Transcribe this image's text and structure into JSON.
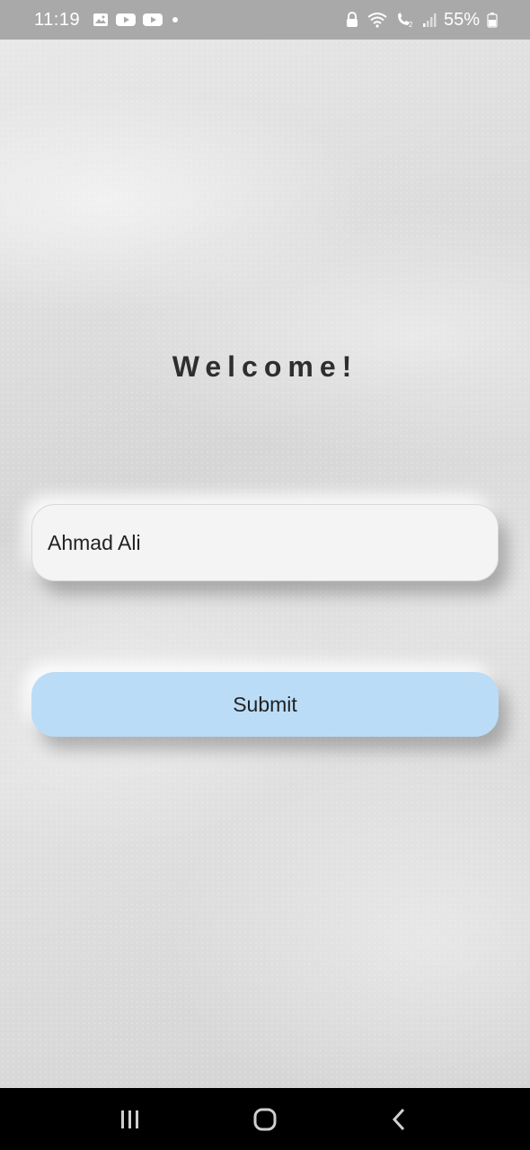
{
  "status_bar": {
    "time": "11:19",
    "battery_percent": "55%",
    "icons_left": [
      "image-icon",
      "youtube-icon",
      "youtube-icon",
      "dot-icon"
    ],
    "icons_right": [
      "lock-icon",
      "wifi-icon",
      "call-icon",
      "signal-icon",
      "battery-icon"
    ]
  },
  "main": {
    "welcome_text": "Welcome!",
    "name_input": {
      "value": "Ahmad Ali"
    },
    "submit_label": "Submit"
  },
  "nav_bar": {
    "icons": [
      "recents-icon",
      "home-icon",
      "back-icon"
    ]
  },
  "colors": {
    "status_bar_bg": "#a9a9a9",
    "submit_bg": "#bbdcf7",
    "input_bg": "#f4f4f4",
    "nav_bar_bg": "#000000"
  }
}
